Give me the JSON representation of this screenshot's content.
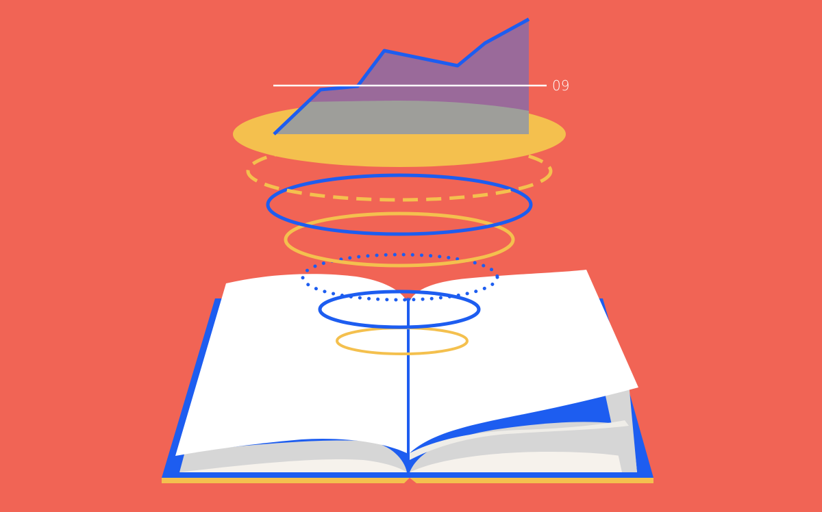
{
  "illustration": {
    "chart_label": "09"
  },
  "colors": {
    "background": "#F16455",
    "blue": "#1D5DF0",
    "yellow": "#F4C04E",
    "purple_area": "#9A6A9A",
    "gray_area": "#9E9E9A",
    "page_white": "#FFFFFF",
    "page_shadow": "#D6D6D6",
    "page_cream": "#F6F2EC"
  }
}
